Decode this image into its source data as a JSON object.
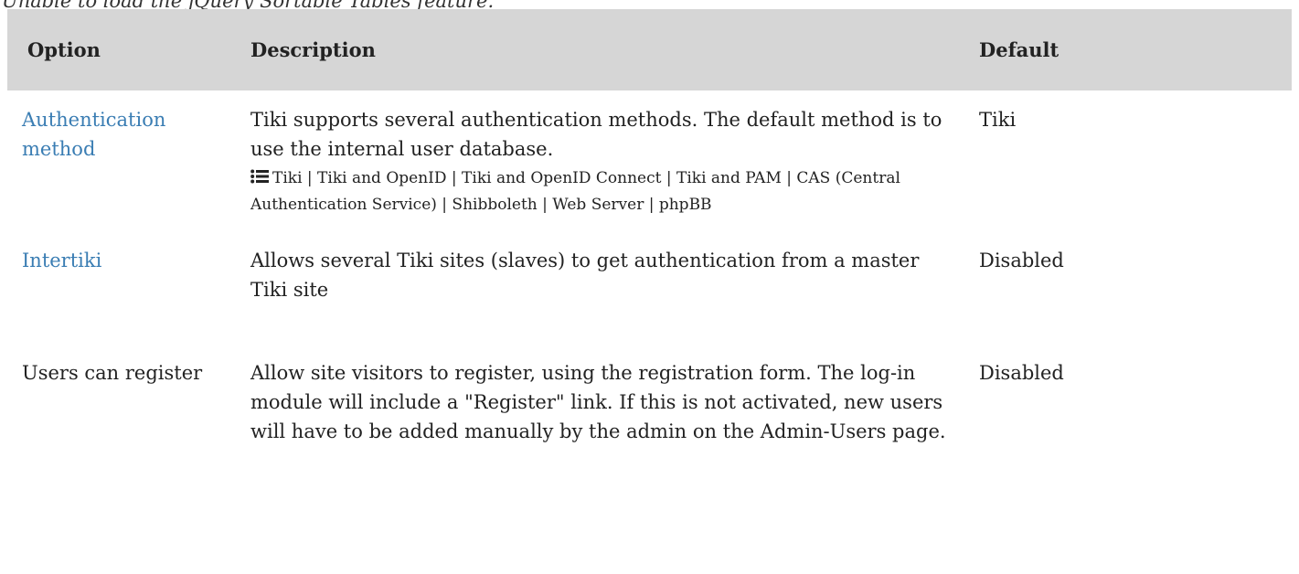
{
  "notice": "Unable to load the jQuery Sortable Tables feature.",
  "table": {
    "headers": [
      "Option",
      "Description",
      "Default"
    ],
    "rows": [
      {
        "option": "Authentication method",
        "option_is_link": true,
        "description": "Tiki supports several authentication methods. The default method is to use the internal user database.",
        "values": "Tiki | Tiki and OpenID | Tiki and OpenID Connect | Tiki and PAM | CAS (Central Authentication Service) | Shibboleth | Web Server | phpBB",
        "values_icon": "list-icon",
        "default": "Tiki"
      },
      {
        "option": "Intertiki",
        "option_is_link": true,
        "description": "Allows several Tiki sites (slaves) to get authentication from a master Tiki site",
        "default": "Disabled"
      },
      {
        "option": "Users can register",
        "option_is_link": false,
        "description": "Allow site visitors to register, using the registration form. The log-in module will include a \"Register\" link. If this is not activated, new users will have to be added manually by the admin on the Admin-Users page.",
        "default": "Disabled"
      }
    ]
  },
  "colors": {
    "link": "#3a7db3",
    "header_bg": "#d6d6d6",
    "text": "#222222"
  }
}
